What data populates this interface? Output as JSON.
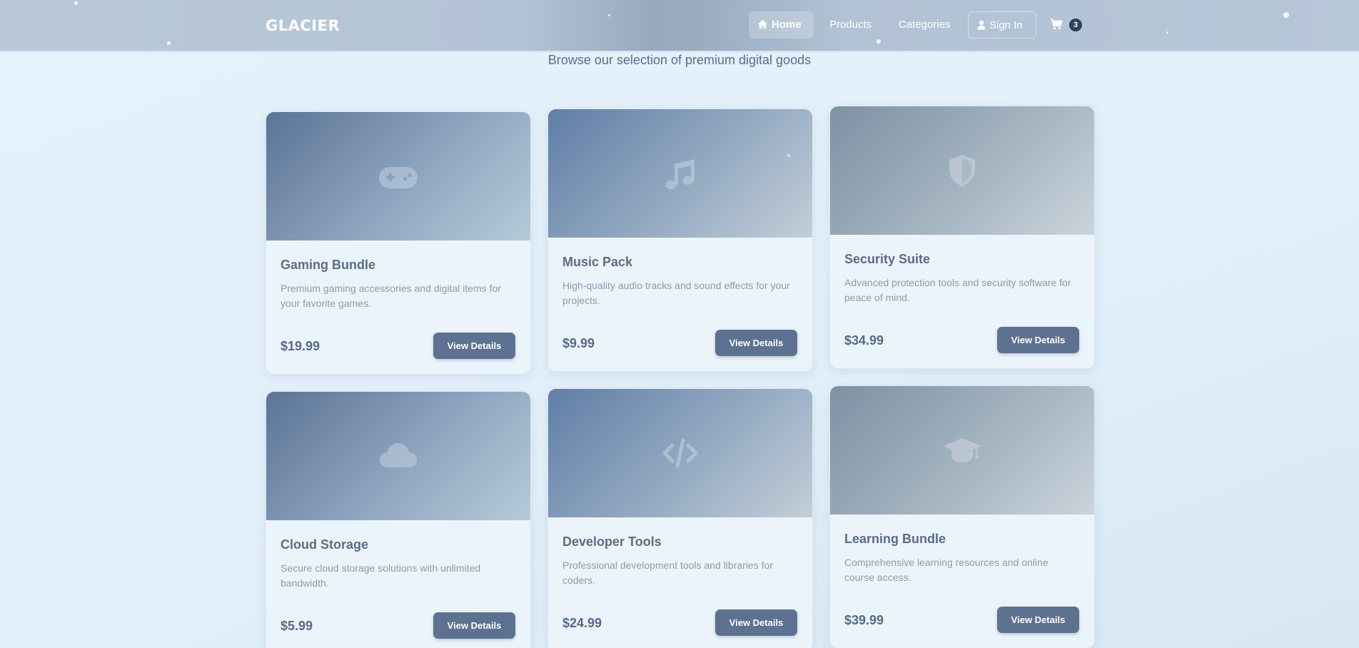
{
  "brand": {
    "logo": "GLACIER"
  },
  "nav": {
    "home": "Home",
    "products": "Products",
    "categories": "Categories",
    "signin": "Sign In",
    "cart_count": "3"
  },
  "subtitle": "Browse our selection of premium digital goods",
  "products": [
    {
      "title": "Gaming Bundle",
      "desc": "Premium gaming accessories and digital items for your favorite games.",
      "price": "$19.99",
      "button": "View Details",
      "icon": "gamepad-icon"
    },
    {
      "title": "Music Pack",
      "desc": "High-quality audio tracks and sound effects for your projects.",
      "price": "$9.99",
      "button": "View Details",
      "icon": "music-note-icon"
    },
    {
      "title": "Security Suite",
      "desc": "Advanced protection tools and security software for peace of mind.",
      "price": "$34.99",
      "button": "View Details",
      "icon": "shield-icon"
    },
    {
      "title": "Cloud Storage",
      "desc": "Secure cloud storage solutions with unlimited bandwidth.",
      "price": "$5.99",
      "button": "View Details",
      "icon": "cloud-icon"
    },
    {
      "title": "Developer Tools",
      "desc": "Professional development tools and libraries for coders.",
      "price": "$24.99",
      "button": "View Details",
      "icon": "code-icon"
    },
    {
      "title": "Learning Bundle",
      "desc": "Comprehensive learning resources and online course access.",
      "price": "$39.99",
      "button": "View Details",
      "icon": "graduation-cap-icon"
    }
  ],
  "colors": {
    "accent": "#5c7290",
    "badge": "#2f4059",
    "nav_bg": "#b3c4d6",
    "page_bg": "#e6f2fb"
  }
}
